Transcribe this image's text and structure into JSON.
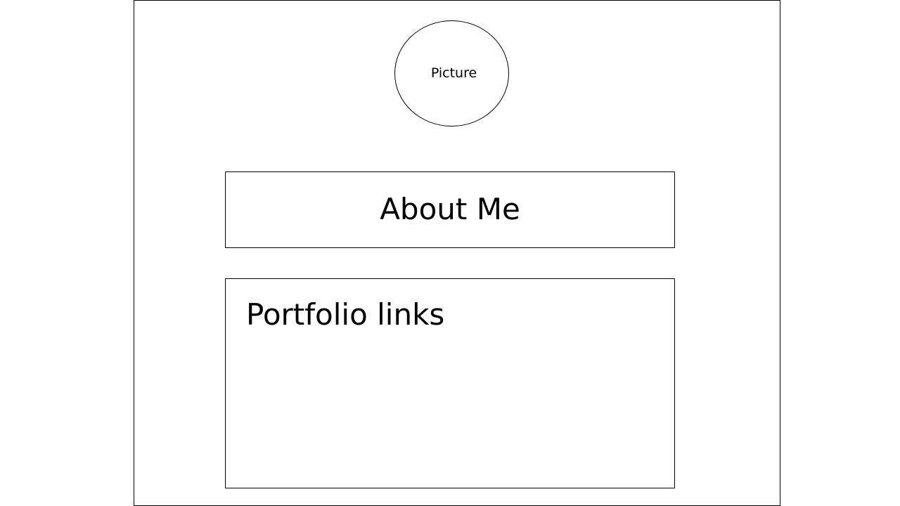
{
  "picture": {
    "label": "Picture"
  },
  "about": {
    "title": "About Me"
  },
  "portfolio": {
    "title": "Portfolio links"
  }
}
